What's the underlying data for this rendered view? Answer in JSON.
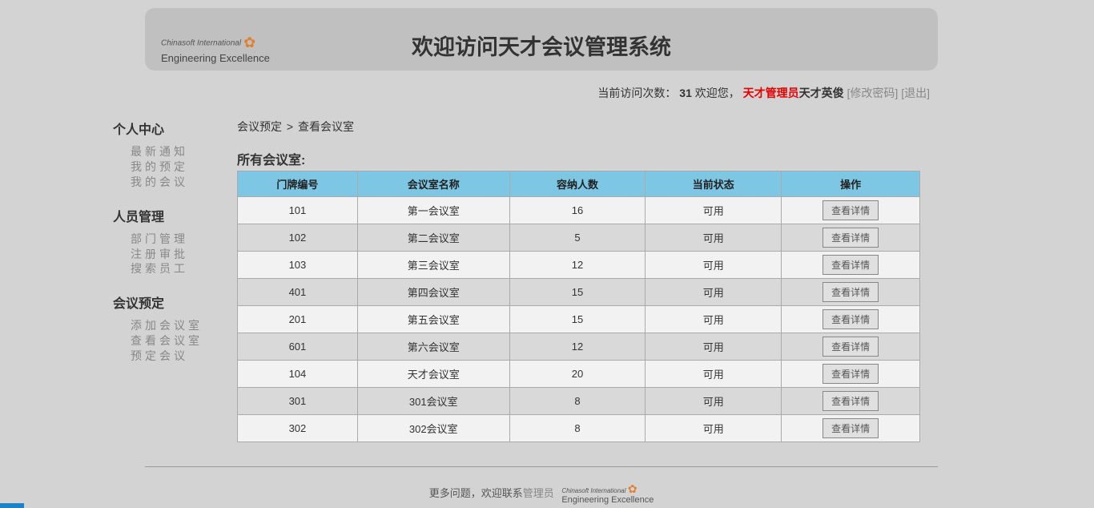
{
  "logo": {
    "line1": "Chinasoft International",
    "line2": "Engineering Excellence"
  },
  "header": {
    "title": "欢迎访问天才会议管理系统"
  },
  "status": {
    "visit_label": "当前访问次数：",
    "visit_count": "31",
    "welcome": "欢迎您，",
    "role": "天才管理员",
    "name": "天才英俊",
    "change_pwd": "[修改密码]",
    "logout": "[退出]"
  },
  "sidebar": {
    "personal": {
      "title": "个人中心",
      "items": [
        "最新通知",
        "我的预定",
        "我的会议"
      ]
    },
    "staff": {
      "title": "人员管理",
      "items": [
        "部门管理",
        "注册审批",
        "搜索员工"
      ]
    },
    "meeting": {
      "title": "会议预定",
      "items": [
        "添加会议室",
        "查看会议室",
        "预定会议"
      ]
    }
  },
  "breadcrumb": {
    "a": "会议预定",
    "sep": ">",
    "b": "查看会议室"
  },
  "section_title": "所有会议室:",
  "table": {
    "headers": [
      "门牌编号",
      "会议室名称",
      "容纳人数",
      "当前状态",
      "操作"
    ],
    "action_label": "查看详情",
    "rows": [
      {
        "num": "101",
        "name": "第一会议室",
        "cap": "16",
        "status": "可用"
      },
      {
        "num": "102",
        "name": "第二会议室",
        "cap": "5",
        "status": "可用"
      },
      {
        "num": "103",
        "name": "第三会议室",
        "cap": "12",
        "status": "可用"
      },
      {
        "num": "401",
        "name": "第四会议室",
        "cap": "15",
        "status": "可用"
      },
      {
        "num": "201",
        "name": "第五会议室",
        "cap": "15",
        "status": "可用"
      },
      {
        "num": "601",
        "name": "第六会议室",
        "cap": "12",
        "status": "可用"
      },
      {
        "num": "104",
        "name": "天才会议室",
        "cap": "20",
        "status": "可用"
      },
      {
        "num": "301",
        "name": "301会议室",
        "cap": "8",
        "status": "可用"
      },
      {
        "num": "302",
        "name": "302会议室",
        "cap": "8",
        "status": "可用"
      }
    ]
  },
  "footer": {
    "text": "更多问题，欢迎联系",
    "link": "管理员"
  }
}
